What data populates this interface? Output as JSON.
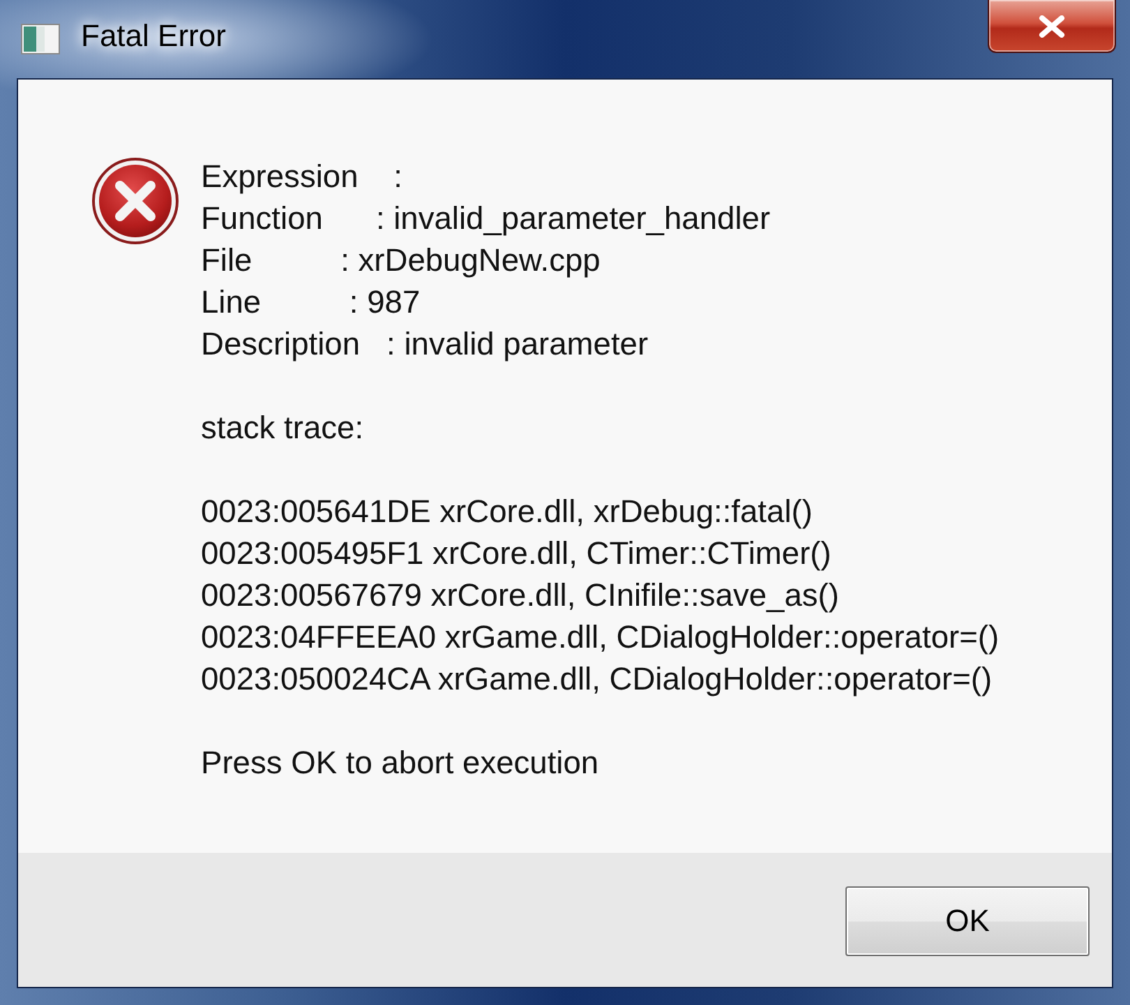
{
  "window": {
    "title": "Fatal Error"
  },
  "message": {
    "details": [
      "Expression    :",
      "Function      : invalid_parameter_handler",
      "File          : xrDebugNew.cpp",
      "Line          : 987",
      "Description   : invalid parameter"
    ],
    "stack_trace_heading": "stack trace:",
    "stack_trace": [
      "0023:005641DE xrCore.dll, xrDebug::fatal()",
      "0023:005495F1 xrCore.dll, CTimer::CTimer()",
      "0023:00567679 xrCore.dll, CInifile::save_as()",
      "0023:04FFEEA0 xrGame.dll, CDialogHolder::operator=()",
      "0023:050024CA xrGame.dll, CDialogHolder::operator=()"
    ],
    "prompt": "Press OK to abort execution"
  },
  "buttons": [
    {
      "label": "OK"
    }
  ]
}
